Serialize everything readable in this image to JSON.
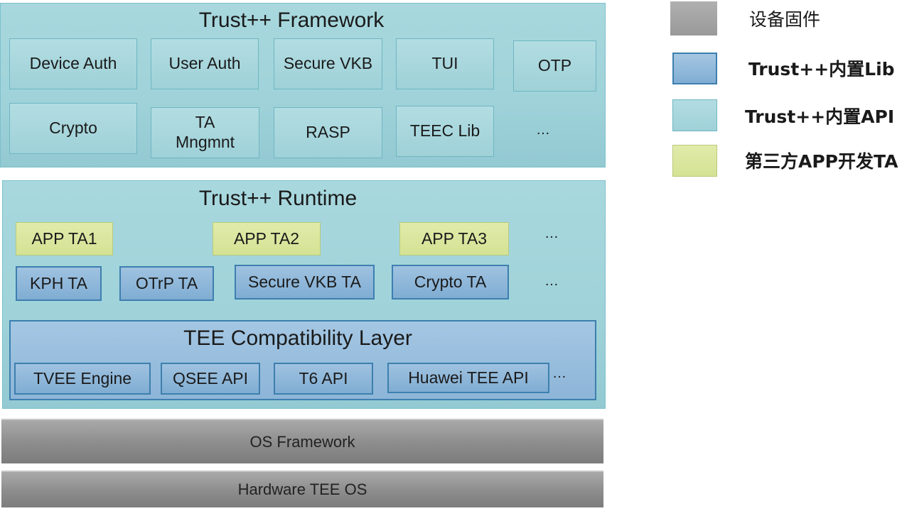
{
  "framework": {
    "title": "Trust++ Framework",
    "row1": [
      "Device Auth",
      "User Auth",
      "Secure VKB",
      "TUI",
      "OTP"
    ],
    "row2": [
      "Crypto",
      "TA\nMngmnt",
      "RASP",
      "TEEC Lib",
      "…"
    ]
  },
  "runtime": {
    "title": "Trust++ Runtime",
    "app_tas": [
      "APP TA1",
      "APP TA2",
      "APP TA3",
      "…"
    ],
    "lib_tas": [
      "KPH TA",
      "OTrP TA",
      "Secure VKB TA",
      "Crypto TA",
      "…"
    ]
  },
  "compat": {
    "title": "TEE Compatibility Layer",
    "items": [
      "TVEE Engine",
      "QSEE API",
      "T6 API",
      "Huawei TEE API",
      "…"
    ]
  },
  "os_framework": "OS Framework",
  "hardware_tee_os": "Hardware TEE OS",
  "legend": [
    {
      "label": "设备固件",
      "color": "#a6a6a6"
    },
    {
      "label": "Trust++内置Lib",
      "color": "#8db5d8"
    },
    {
      "label": "Trust++内置API",
      "color": "#a8d8de"
    },
    {
      "label": "第三方APP开发TA",
      "color": "#d8e39a"
    }
  ]
}
